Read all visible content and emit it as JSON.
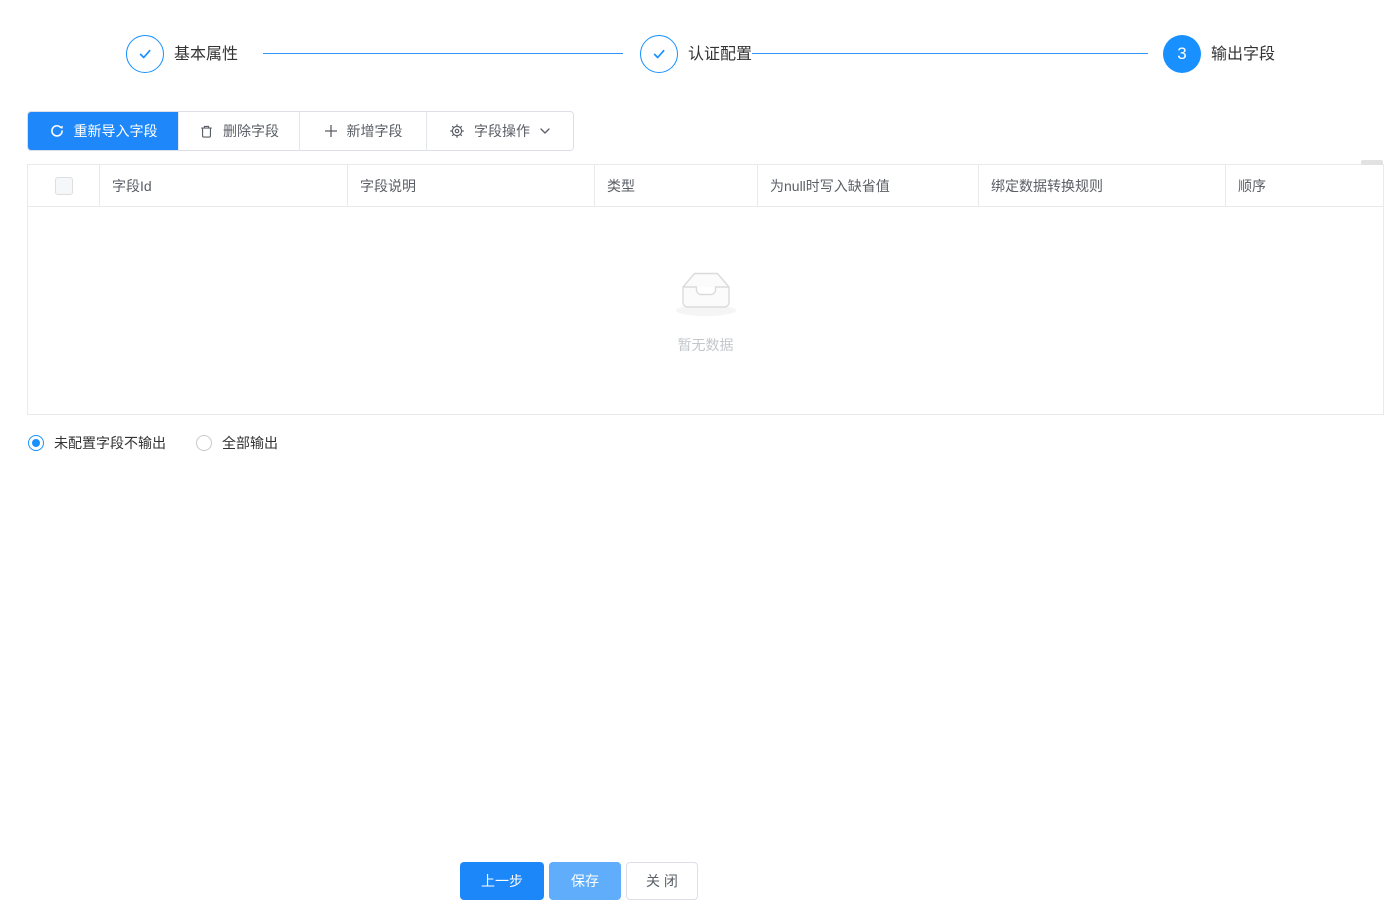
{
  "steps": {
    "items": [
      {
        "title": "基本属性",
        "status": "finished"
      },
      {
        "title": "认证配置",
        "status": "finished"
      },
      {
        "title": "输出字段",
        "status": "current",
        "number": "3"
      }
    ]
  },
  "toolbar": {
    "buttons": [
      {
        "label": "重新导入字段",
        "icon": "reload-icon",
        "type": "primary"
      },
      {
        "label": "删除字段",
        "icon": "trash-icon",
        "type": "default"
      },
      {
        "label": "新增字段",
        "icon": "plus-icon",
        "type": "default"
      },
      {
        "label": "字段操作",
        "icon": "gear-icon",
        "type": "default",
        "has_dropdown": true
      }
    ]
  },
  "table": {
    "columns": [
      "字段Id",
      "字段说明",
      "类型",
      "为null时写入缺省值",
      "绑定数据转换规则",
      "顺序"
    ],
    "rows": [],
    "select_all_checked": false,
    "empty_text": "暂无数据"
  },
  "output_mode": {
    "options": [
      {
        "label": "未配置字段不输出",
        "selected": true
      },
      {
        "label": "全部输出",
        "selected": false
      }
    ]
  },
  "footer": {
    "buttons": [
      {
        "label": "上一步",
        "type": "primary"
      },
      {
        "label": "保存",
        "type": "primary-light"
      },
      {
        "label": "关 闭",
        "type": "default"
      }
    ]
  },
  "colors": {
    "primary": "#1e88fa",
    "primary_light": "#5fadfb",
    "step_line": "#2f94fb",
    "table_border": "#e8eaec",
    "muted_text": "#5a5e66",
    "empty_text": "#c3c7cc"
  }
}
